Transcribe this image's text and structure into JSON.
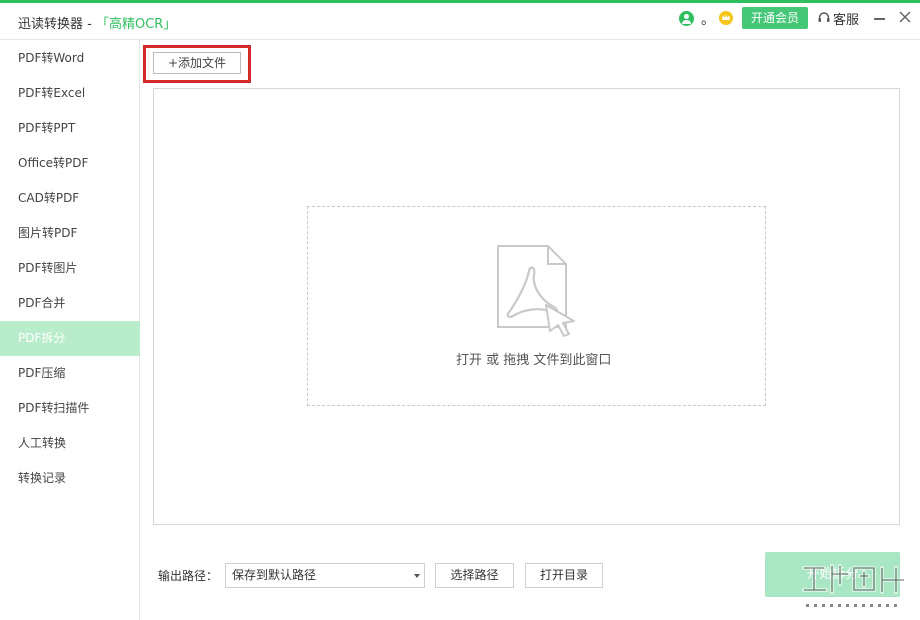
{
  "window": {
    "title": "迅读转换器 - ",
    "subtitle": "「高精OCR」",
    "dot": "。",
    "vip_label": "开通会员",
    "support_label": "客服"
  },
  "sidebar": {
    "items": [
      {
        "label": "PDF转Word"
      },
      {
        "label": "PDF转Excel"
      },
      {
        "label": "PDF转PPT"
      },
      {
        "label": "Office转PDF"
      },
      {
        "label": "CAD转PDF"
      },
      {
        "label": "图片转PDF"
      },
      {
        "label": "PDF转图片"
      },
      {
        "label": "PDF合并"
      },
      {
        "label": "PDF拆分"
      },
      {
        "label": "PDF压缩"
      },
      {
        "label": "PDF转扫描件"
      },
      {
        "label": "人工转换"
      },
      {
        "label": "转换记录"
      }
    ],
    "active_index": 8
  },
  "main": {
    "add_file_label": "+添加文件",
    "drop_text": "打开 或 拖拽 文件到此窗口"
  },
  "footer": {
    "output_label": "输出路径：",
    "path_value": "保存到默认路径",
    "choose_path_label": "选择路径",
    "open_dir_label": "打开目录",
    "start_label": "开始拆分"
  },
  "colors": {
    "accent": "#2fbf5f",
    "active_item": "#b9ecca",
    "highlight": "#d42a2a"
  }
}
